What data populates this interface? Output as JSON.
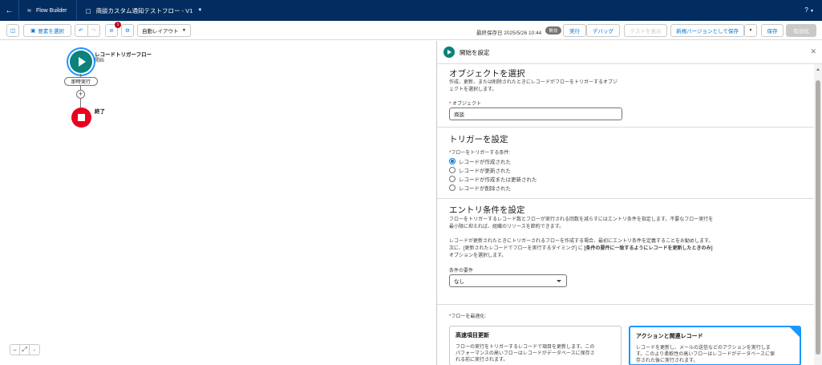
{
  "topbar": {
    "app_name": "Flow Builder",
    "flow_name": "商談カスタム通知テストフロー - V1",
    "help": "?"
  },
  "toolbar": {
    "select_elements": "要素を選択",
    "error_count": "1",
    "layout": "自動レイアウト",
    "last_saved": "最終保存日 2025/5/26 10:44",
    "status": "無効",
    "run": "実行",
    "debug": "デバッグ",
    "view_tests": "テストを表示",
    "save_as_new_version": "新規バージョンとして保存",
    "save": "保存",
    "activate": "有効化"
  },
  "canvas": {
    "start_title": "レコードトリガーフロー",
    "start_sub": "開始",
    "scheduled_path": "即時実行",
    "end_title": "終了"
  },
  "panel": {
    "title": "開始を設定",
    "object_section": {
      "title": "オブジェクトを選択",
      "desc_line1": "作成、更新、または削除されたときにレコードがフローをトリガーするオブジ",
      "desc_line2": "ェクトを選択します。",
      "label": "オブジェクト",
      "value": "商談"
    },
    "trigger_section": {
      "title": "トリガーを設定",
      "label": "フローをトリガーする条件:",
      "options": [
        "レコードが作成された",
        "レコードが更新された",
        "レコードが作成または更新された",
        "レコードが削除された"
      ],
      "selected_index": 0
    },
    "entry_section": {
      "title": "エントリ条件を設定",
      "desc1_line1": "フローをトリガーするレコード数とフローが実行される回数を減らすにはエントリ条件を指定します。不要なフロー実行を",
      "desc1_line2": "最小限に抑えれば、組織のリソースを節約できます。",
      "desc2_line1": "レコードが更新されたときにトリガーされるフローを作成する場合、最初にエントリ条件を定義することをお勧めします。",
      "desc2_line2_a": "次に、[更新されたレコードでフローを実行するタイミング] に ",
      "desc2_line2_b": "[条件の要件に一致するようにレコードを更新したときのみ]",
      "desc2_line3": "オプションを選択します。",
      "condition_label": "条件の要件",
      "condition_value": "なし"
    },
    "optimize_section": {
      "label": "フローを最適化:",
      "card1": {
        "title": "高速項目更新",
        "line1": "フローの実行をトリガーするレコードで項目を更新します。この",
        "line2": "パフォーマンスの高いフローはレコードがデータベースに保存さ",
        "line3": "れる前に実行されます。"
      },
      "card2": {
        "title": "アクションと関連レコード",
        "line1": "レコードを更新し、メールの送信などのアクションを実行しま",
        "line2": "す。このより柔軟性の高いフローはレコードがデータベースに保",
        "line3": "存された後に実行されます。"
      }
    }
  }
}
